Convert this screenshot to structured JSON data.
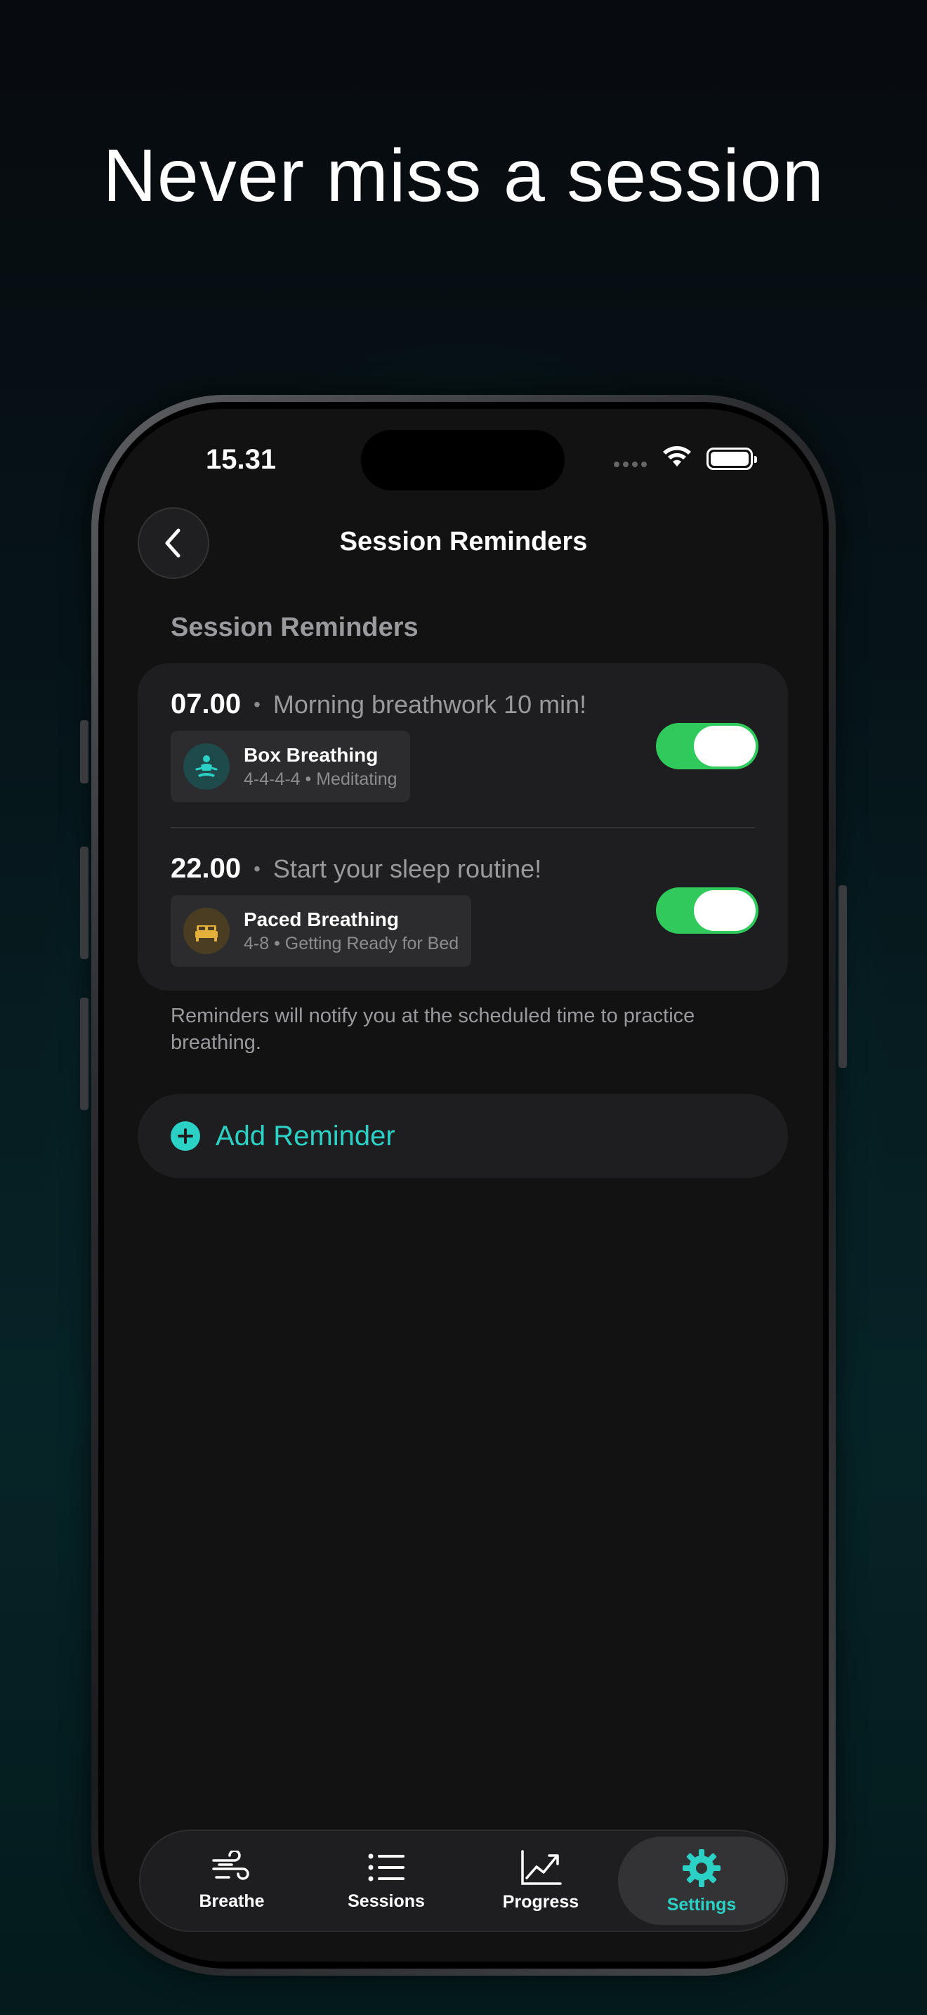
{
  "headline": "Never miss a session",
  "status_bar": {
    "time": "15.31"
  },
  "nav": {
    "title": "Session Reminders",
    "back_icon": "chevron-left-icon"
  },
  "section": {
    "title": "Session Reminders"
  },
  "reminders": [
    {
      "time": "07.00",
      "separator": "•",
      "message": "Morning breathwork 10 min!",
      "exercise_name": "Box Breathing",
      "exercise_detail": "4-4-4-4 • Meditating",
      "icon": "meditation-icon",
      "icon_color": "#2bd1c4",
      "icon_bg": "#1f4a4b",
      "enabled": true
    },
    {
      "time": "22.00",
      "separator": "•",
      "message": "Start your sleep routine!",
      "exercise_name": "Paced Breathing",
      "exercise_detail": "4-8 • Getting Ready for Bed",
      "icon": "bed-icon",
      "icon_color": "#e3b03c",
      "icon_bg": "#4a3d22",
      "enabled": true
    }
  ],
  "footnote": "Reminders will notify you at the scheduled time to practice breathing.",
  "add_button": {
    "label": "Add Reminder",
    "icon": "plus-circle-icon"
  },
  "tabs": [
    {
      "label": "Breathe",
      "icon": "wind-icon",
      "active": false
    },
    {
      "label": "Sessions",
      "icon": "list-icon",
      "active": false
    },
    {
      "label": "Progress",
      "icon": "chart-icon",
      "active": false
    },
    {
      "label": "Settings",
      "icon": "gear-icon",
      "active": true
    }
  ],
  "colors": {
    "accent": "#2bd1c4",
    "toggle_on": "#30c95b",
    "background": "#121212",
    "card": "#1e1e20"
  }
}
